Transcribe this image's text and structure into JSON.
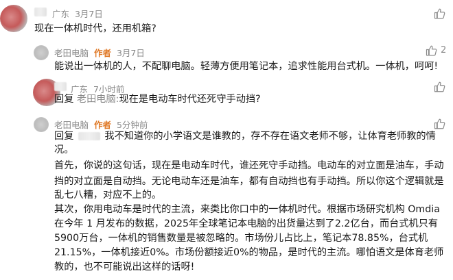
{
  "comments": [
    {
      "region": "广东",
      "time": "3月7日",
      "text": "现在一体机时代，还用机箱?"
    },
    {
      "author": "老田电脑",
      "badge": "作者",
      "time": "3月7日",
      "like_count": "2",
      "text": "能说出一体机的人，不配聊电脑。轻薄方便用笔记本，追求性能用台式机。一体机，呵呵!"
    },
    {
      "region": "广东",
      "time": "7小时前",
      "reply_prefix": "回复",
      "reply_to": "老田电脑:",
      "text": "现在是电动车时代还死守手动挡?"
    },
    {
      "author": "老田电脑",
      "badge": "作者",
      "time": "5分钟前",
      "reply_prefix": "回复",
      "lines": [
        "我不知道你的小学语文是谁教的，存不存在语文老师不够，让体育老师教的情",
        "况。",
        "首先，你说的这句话，现在是电动车时代，谁还死守手动挡。电动车的对立面是油车，手动",
        "挡的对立面是自动挡。无论电动车还是油车，都有自动挡也有手动挡。所以你这个逻辑就是",
        "乱七八糟，对应不上的。",
        "其次，你用电动车是时代的主流，来类比你口中的一体机时代。根据市场研究机构 Omdia",
        "在今年 1 月发布的数据，2025年全球笔记本电脑的出货量达到了2.2亿台，而台式机只有",
        "5900万台，一体机的销售数量是被忽略的。市场份儿占比上，笔记本78.85%，台式机",
        "21.15%，一体机接近0%。市场份额接近0%的物品，是时代的主流。哪怕语文是体育老师",
        "教的，也不可能说出这样的话呀!"
      ]
    }
  ],
  "icons": {
    "like": "thumbs-up-icon"
  },
  "colors": {
    "author_badge": "#e07a28",
    "meta_gray": "#8a8a8a"
  }
}
